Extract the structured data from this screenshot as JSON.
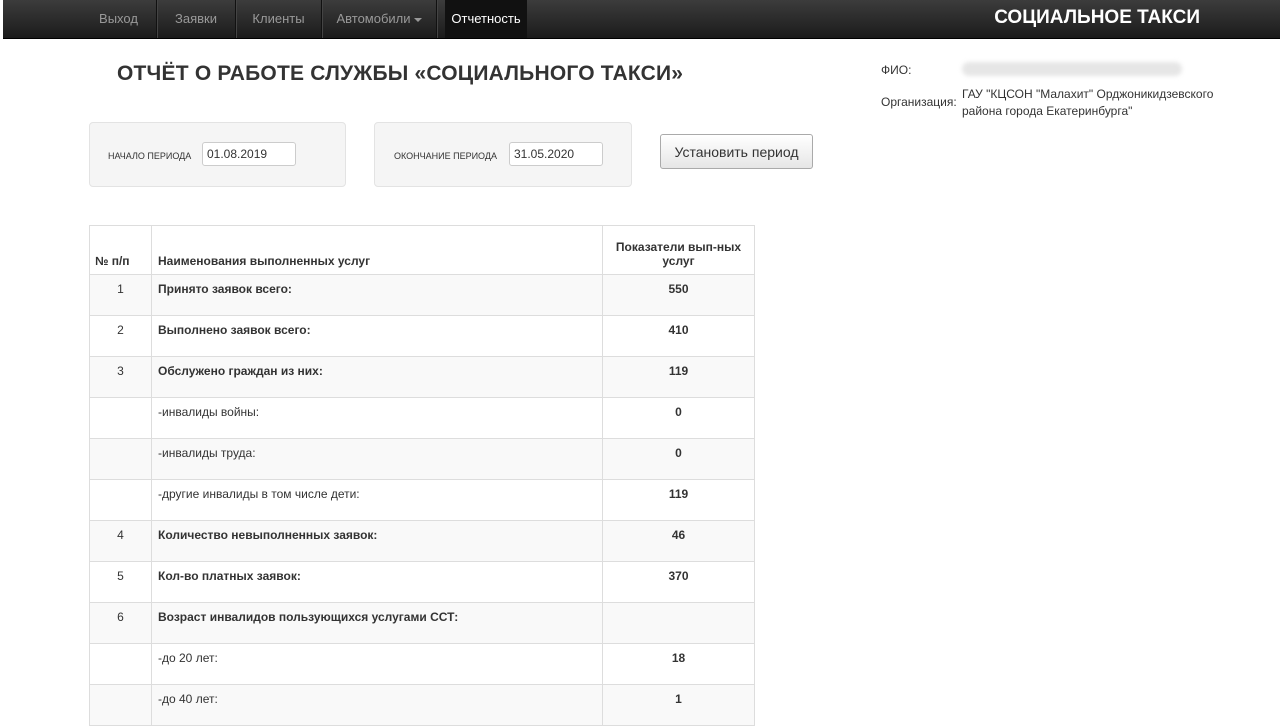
{
  "nav": {
    "items": [
      "Выход",
      "Заявки",
      "Клиенты",
      "Автомобили",
      "Отчетность"
    ],
    "brand": "СОЦИАЛЬНОЕ ТАКСИ"
  },
  "page": {
    "title": "ОТЧЁТ О РАБОТЕ СЛУЖБЫ «СОЦИАЛЬНОГО ТАКСИ»"
  },
  "info": {
    "fio_label": "ФИО:",
    "org_label": "Организация:",
    "org_value": "ГАУ \"КЦСОН \"Малахит\" Орджоникидзевского района города Екатеринбурга\""
  },
  "period": {
    "start_label": "НАЧАЛО ПЕРИОДА",
    "start_value": "01.08.2019",
    "end_label": "ОКОНЧАНИЕ ПЕРИОДА",
    "end_value": "31.05.2020",
    "button_label": "Установить период"
  },
  "table": {
    "headers": [
      "№ п/п",
      "Наименования выполненных услуг",
      "Показатели вып-ных услуг"
    ],
    "rows": [
      {
        "num": "1",
        "name": "Принято заявок всего:",
        "value": "550"
      },
      {
        "num": "2",
        "name": "Выполнено заявок всего:",
        "value": "410"
      },
      {
        "num": "3",
        "name": "Обслужено граждан из них:",
        "value": "119"
      },
      {
        "num": "",
        "name": "-инвалиды войны:",
        "value": "0"
      },
      {
        "num": "",
        "name": "-инвалиды труда:",
        "value": "0"
      },
      {
        "num": "",
        "name": "-другие инвалиды в том числе дети:",
        "value": "119"
      },
      {
        "num": "4",
        "name": "Количество невыполненных заявок:",
        "value": "46"
      },
      {
        "num": "5",
        "name": "Кол-во платных заявок:",
        "value": "370"
      },
      {
        "num": "6",
        "name": "Возраст инвалидов пользующихся услугами ССТ:",
        "value": ""
      },
      {
        "num": "",
        "name": "-до 20 лет:",
        "value": "18"
      },
      {
        "num": "",
        "name": "-до 40 лет:",
        "value": "1"
      }
    ]
  }
}
